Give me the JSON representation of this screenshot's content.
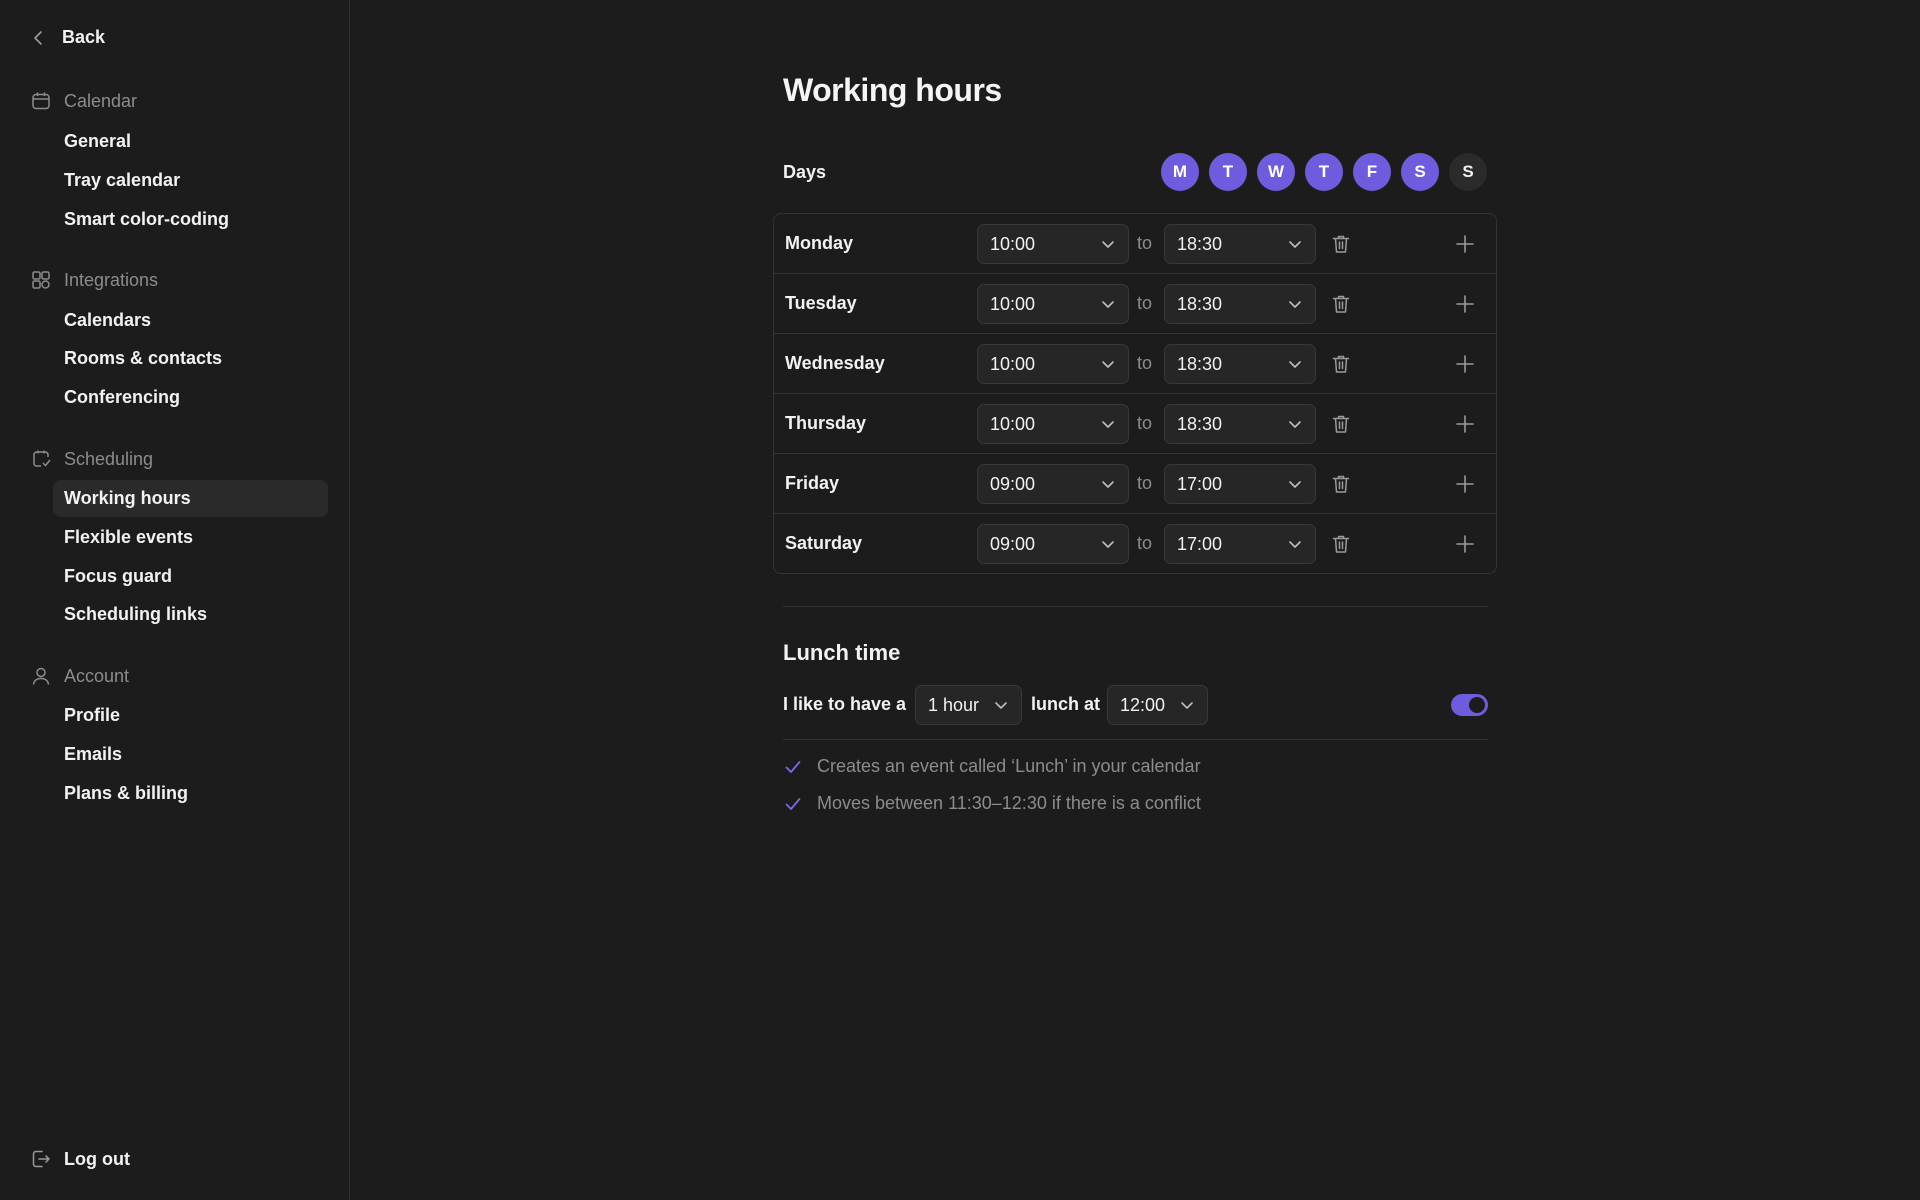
{
  "sidebar": {
    "back_label": "Back",
    "sections": [
      {
        "title": "Calendar",
        "items": [
          "General",
          "Tray calendar",
          "Smart color-coding"
        ]
      },
      {
        "title": "Integrations",
        "items": [
          "Calendars",
          "Rooms & contacts",
          "Conferencing"
        ]
      },
      {
        "title": "Scheduling",
        "items": [
          "Working hours",
          "Flexible events",
          "Focus guard",
          "Scheduling links"
        ]
      },
      {
        "title": "Account",
        "items": [
          "Profile",
          "Emails",
          "Plans & billing"
        ]
      }
    ],
    "active_item": "Working hours",
    "logout_label": "Log out"
  },
  "main": {
    "title": "Working hours",
    "days_label": "Days",
    "day_toggles": [
      {
        "letter": "M",
        "on": true
      },
      {
        "letter": "T",
        "on": true
      },
      {
        "letter": "W",
        "on": true
      },
      {
        "letter": "T",
        "on": true
      },
      {
        "letter": "F",
        "on": true
      },
      {
        "letter": "S",
        "on": true
      },
      {
        "letter": "S",
        "on": false
      }
    ],
    "to_label": "to",
    "rows": [
      {
        "day": "Monday",
        "start": "10:00",
        "end": "18:30"
      },
      {
        "day": "Tuesday",
        "start": "10:00",
        "end": "18:30"
      },
      {
        "day": "Wednesday",
        "start": "10:00",
        "end": "18:30"
      },
      {
        "day": "Thursday",
        "start": "10:00",
        "end": "18:30"
      },
      {
        "day": "Friday",
        "start": "09:00",
        "end": "17:00"
      },
      {
        "day": "Saturday",
        "start": "09:00",
        "end": "17:00"
      }
    ],
    "lunch": {
      "title": "Lunch time",
      "prefix": "I like to have a",
      "duration": "1 hour",
      "middle": "lunch at",
      "time": "12:00",
      "enabled": true,
      "notes": [
        "Creates an event called ‘Lunch’ in your calendar",
        "Moves between 11:30–12:30 if there is a conflict"
      ]
    }
  },
  "colors": {
    "accent": "#6e5cdf",
    "background": "#1c1c1c",
    "muted_text": "#8c8c8c"
  }
}
